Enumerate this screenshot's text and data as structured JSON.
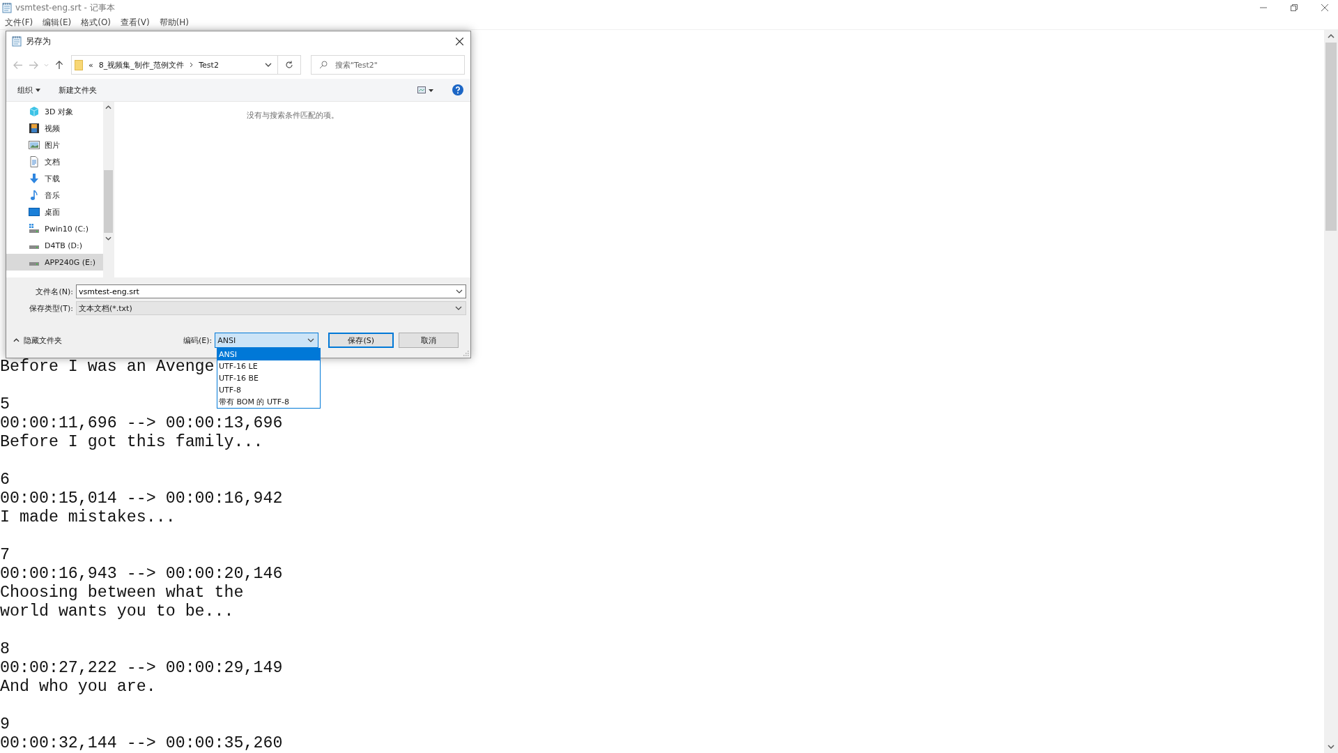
{
  "window": {
    "title": "vsmtest-eng.srt - 记事本"
  },
  "menu": [
    "文件(F)",
    "编辑(E)",
    "格式(O)",
    "查看(V)",
    "帮助(H)"
  ],
  "document": {
    "cues": [
      {
        "text": [
          "Before I was an Avenge"
        ]
      },
      {
        "index": "5",
        "time": "00:00:11,696 --> 00:00:13,696",
        "text": [
          "Before I got this family..."
        ]
      },
      {
        "index": "6",
        "time": "00:00:15,014 --> 00:00:16,942",
        "text": [
          "I made mistakes..."
        ]
      },
      {
        "index": "7",
        "time": "00:00:16,943 --> 00:00:20,146",
        "text": [
          "Choosing between what the",
          "world wants you to be..."
        ]
      },
      {
        "index": "8",
        "time": "00:00:27,222 --> 00:00:29,149",
        "text": [
          "And who you are."
        ]
      },
      {
        "index": "9",
        "time": "00:00:32,144 --> 00:00:35,260"
      }
    ]
  },
  "dialog": {
    "title": "另存为",
    "breadcrumb": {
      "overflow": "«",
      "segments": [
        "8_视频集_制作_范例文件",
        "Test2"
      ]
    },
    "search": {
      "placeholder": "搜索\"Test2\""
    },
    "toolbar": [
      {
        "label": "组织",
        "kind": "menu"
      },
      {
        "label": "新建文件夹",
        "kind": "button"
      }
    ],
    "nav_items": [
      {
        "label": "3D 对象",
        "kind": "cube",
        "selected": false
      },
      {
        "label": "视频",
        "kind": "video",
        "selected": false
      },
      {
        "label": "图片",
        "kind": "picture",
        "selected": false
      },
      {
        "label": "文档",
        "kind": "document",
        "selected": false
      },
      {
        "label": "下载",
        "kind": "download",
        "selected": false
      },
      {
        "label": "音乐",
        "kind": "music",
        "selected": false
      },
      {
        "label": "桌面",
        "kind": "desktop",
        "selected": false
      },
      {
        "label": "Pwin10 (C:)",
        "kind": "system",
        "selected": false
      },
      {
        "label": "D4TB (D:)",
        "kind": "drive",
        "selected": false
      },
      {
        "label": "APP240G (E:)",
        "kind": "drive",
        "selected": true
      }
    ],
    "empty_message": "没有与搜索条件匹配的项。",
    "filename": {
      "label": "文件名(N):",
      "value": "vsmtest-eng.srt"
    },
    "filetype": {
      "label": "保存类型(T):",
      "value": "文本文档(*.txt)"
    },
    "hide_folders": "隐藏文件夹",
    "encoding": {
      "label": "编码(E):",
      "value": "ANSI",
      "options": [
        {
          "label": "ANSI",
          "selected": true
        },
        {
          "label": "UTF-16 LE",
          "selected": false
        },
        {
          "label": "UTF-16 BE",
          "selected": false
        },
        {
          "label": "UTF-8",
          "selected": false
        },
        {
          "label": "带有 BOM 的 UTF-8",
          "selected": false
        }
      ]
    },
    "buttons": [
      {
        "label": "保存(S)",
        "default": true
      },
      {
        "label": "取消",
        "default": false
      }
    ]
  }
}
